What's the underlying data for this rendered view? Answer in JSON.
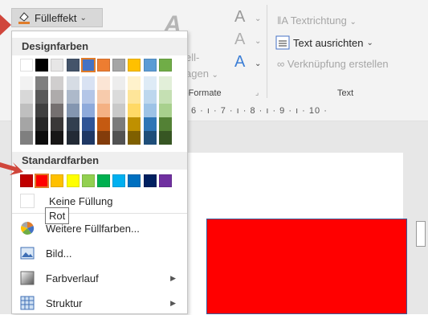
{
  "ribbon": {
    "fill_button_label": "Fülleffekt",
    "fill_button_hotkey": "F",
    "group_formate": "-Formate",
    "text_direction": "Textrichtung",
    "text_align": "Text ausrichten",
    "create_link": "Verknüpfung erstellen",
    "group_text": "Text",
    "partial_ell": "ell-",
    "partial_agen": "agen",
    "ruler": "6 · ı · 7 · ı · 8 · ı · 9 · ı · 10 ·"
  },
  "dropdown": {
    "design_colors_header": "Designfarben",
    "standard_colors_header": "Standardfarben",
    "theme_top_row": [
      "#ffffff",
      "#000000",
      "#e7e6e6",
      "#44546a",
      "#4472c4",
      "#ed7d31",
      "#a5a5a5",
      "#ffc000",
      "#5b9bd5",
      "#70ad47"
    ],
    "theme_shades": [
      [
        "#f2f2f2",
        "#7f7f7f",
        "#d0cece",
        "#d6dce4",
        "#d9e2f3",
        "#fbe5d5",
        "#ededed",
        "#fff2cc",
        "#deebf6",
        "#e2efd9"
      ],
      [
        "#d8d8d8",
        "#595959",
        "#aeabab",
        "#adb9ca",
        "#b4c6e7",
        "#f7cbac",
        "#dbdbdb",
        "#fee599",
        "#bdd7ee",
        "#c5e0b3"
      ],
      [
        "#bfbfbf",
        "#3f3f3f",
        "#757070",
        "#8496b0",
        "#8eaadb",
        "#f4b183",
        "#c9c9c9",
        "#ffd965",
        "#9dc3e6",
        "#a8d08d"
      ],
      [
        "#a5a5a5",
        "#262626",
        "#3a3838",
        "#323f4f",
        "#2f5496",
        "#c55a11",
        "#7b7b7b",
        "#bf9000",
        "#2e75b5",
        "#538135"
      ],
      [
        "#7f7f7f",
        "#0c0c0c",
        "#171616",
        "#222a35",
        "#1f3864",
        "#833c0b",
        "#525252",
        "#7f6000",
        "#1e4e79",
        "#375623"
      ]
    ],
    "standard_colors": [
      "#c00000",
      "#ff0000",
      "#ffc000",
      "#ffff00",
      "#92d050",
      "#00b050",
      "#00b0f0",
      "#0070c0",
      "#002060",
      "#7030a0"
    ],
    "no_fill": "Keine Füllung",
    "tooltip": "Rot",
    "more_colors": "Weitere Füllfarben...",
    "picture": "Bild...",
    "gradient": "Farbverlauf",
    "texture": "Struktur",
    "icons": {
      "more_colors": "color-wheel-icon",
      "picture": "picture-icon",
      "gradient": "gradient-icon",
      "texture": "texture-icon"
    }
  },
  "colors": {
    "accent_arrow": "#d0463b",
    "selected_swatch_border": "#e07c2a",
    "shape_fill": "#ff0000"
  }
}
